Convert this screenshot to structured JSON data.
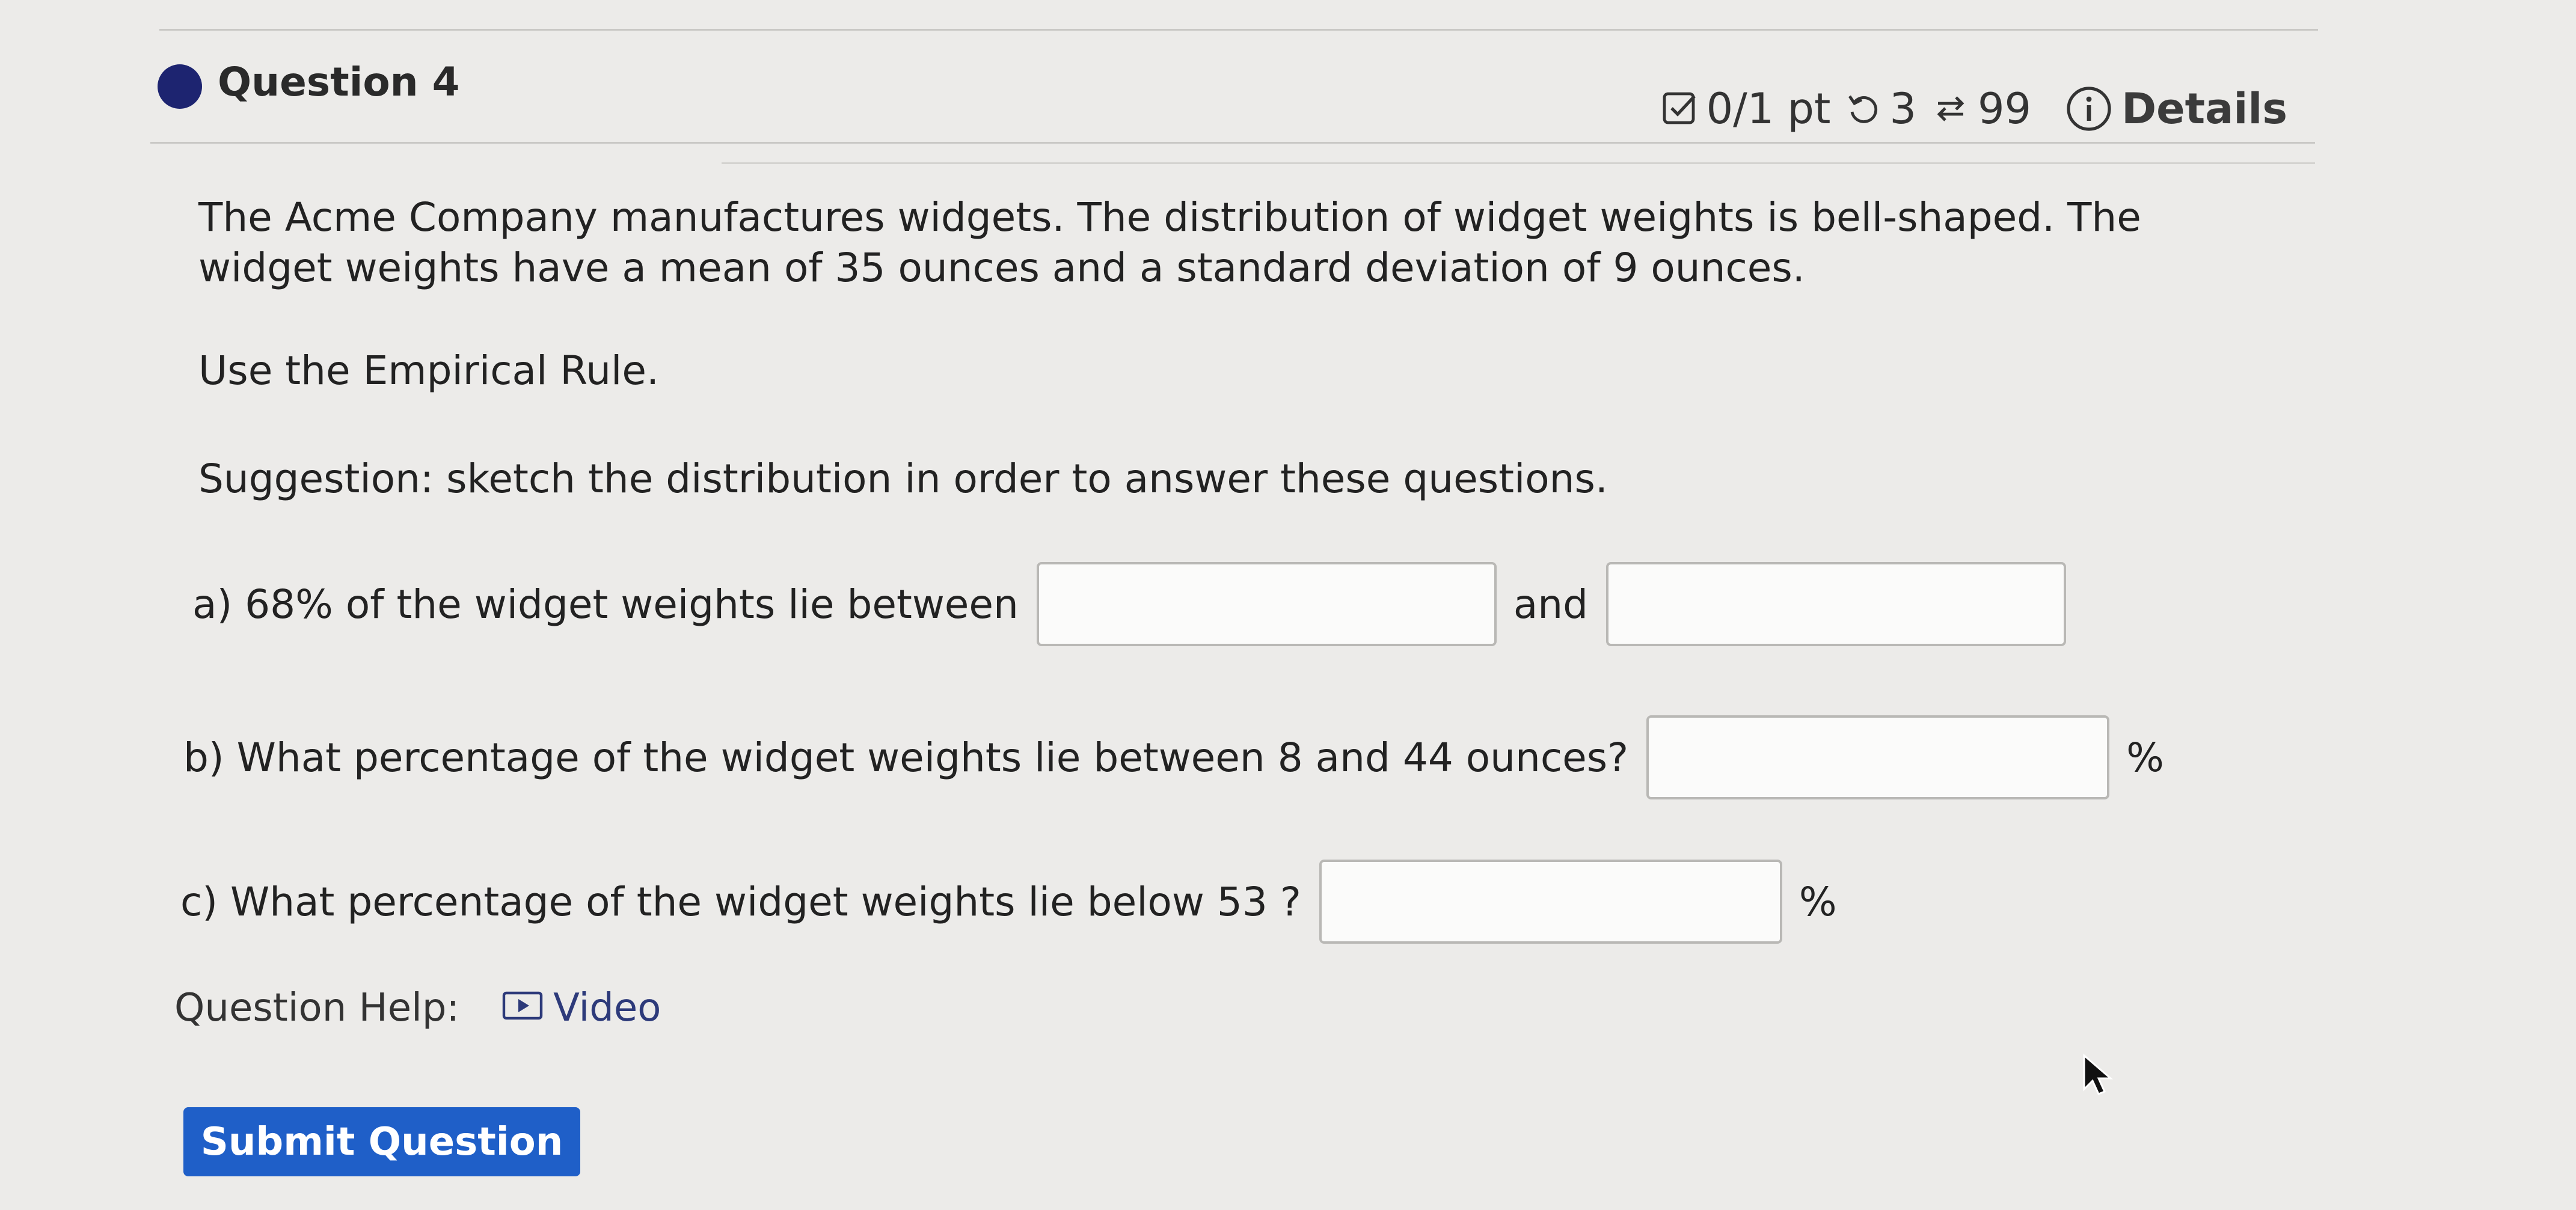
{
  "question": {
    "title": "Question 4",
    "score": "0/1 pt",
    "retries": "3",
    "attempts": "99",
    "details_label": "Details"
  },
  "body": {
    "paragraph1": "The Acme Company manufactures widgets. The distribution of widget weights is bell-shaped. The widget weights have a mean of 35 ounces and a standard deviation of 9 ounces.",
    "paragraph2": "Use the Empirical Rule.",
    "paragraph3": "Suggestion: sketch the distribution in order to answer these questions."
  },
  "parts": {
    "a_label": "a) 68% of the widget weights lie between",
    "a_and": "and",
    "a_value1": "",
    "a_value2": "",
    "b_label": "b) What percentage of the widget weights lie between 8 and 44 ounces?",
    "b_value": "",
    "b_unit": "%",
    "c_label": "c) What percentage of the widget weights lie below 53 ?",
    "c_value": "",
    "c_unit": "%"
  },
  "help": {
    "label": "Question Help:",
    "video_label": "Video"
  },
  "submit_label": "Submit Question",
  "colors": {
    "accent": "#1d2470",
    "button": "#1f5fc8",
    "background": "#ecebe9"
  }
}
